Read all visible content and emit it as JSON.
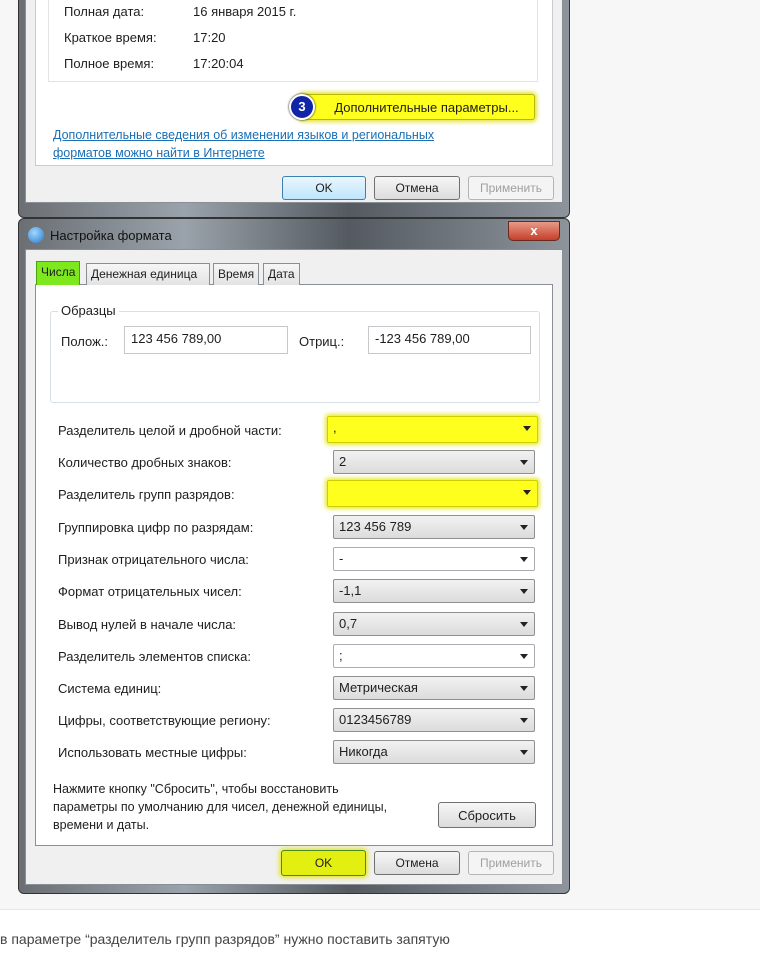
{
  "regional_window": {
    "rows": [
      {
        "label": "Полная дата:",
        "value": "16 января 2015 г."
      },
      {
        "label": "Краткое время:",
        "value": "17:20"
      },
      {
        "label": "Полное время:",
        "value": "17:20:04"
      }
    ],
    "step_badge": "3",
    "additional_button": "Дополнительные параметры...",
    "link_line1": "Дополнительные сведения об изменении языков и региональных",
    "link_line2": "форматов можно найти в Интернете",
    "ok": "OK",
    "cancel": "Отмена",
    "apply": "Применить"
  },
  "format_dialog": {
    "title": "Настройка формата",
    "close": "x",
    "tabs": [
      "Числа",
      "Денежная единица",
      "Время",
      "Дата"
    ],
    "samples": {
      "legend": "Образцы",
      "pos_label": "Полож.:",
      "pos_value": "123 456 789,00",
      "neg_label": "Отриц.:",
      "neg_value": "-123 456 789,00"
    },
    "settings": [
      {
        "label": "Разделитель целой и дробной части:",
        "value": ","
      },
      {
        "label": "Количество дробных знаков:",
        "value": "2"
      },
      {
        "label": "Разделитель групп разрядов:",
        "value": ""
      },
      {
        "label": "Группировка цифр по разрядам:",
        "value": "123 456 789"
      },
      {
        "label": "Признак отрицательного числа:",
        "value": "-"
      },
      {
        "label": "Формат отрицательных чисел:",
        "value": "-1,1"
      },
      {
        "label": "Вывод нулей в начале числа:",
        "value": "0,7"
      },
      {
        "label": "Разделитель элементов списка:",
        "value": ";"
      },
      {
        "label": "Система единиц:",
        "value": "Метрическая"
      },
      {
        "label": "Цифры, соответствующие региону:",
        "value": "0123456789"
      },
      {
        "label": "Использовать местные цифры:",
        "value": "Никогда"
      }
    ],
    "reset_text": [
      "Нажмите кнопку \"Сбросить\", чтобы восстановить",
      "параметры по умолчанию для чисел, денежной единицы,",
      "времени и даты."
    ],
    "reset_button": "Сбросить",
    "ok": "OK",
    "cancel": "Отмена",
    "apply": "Применить"
  },
  "caption": "в параметре “разделитель групп разрядов” нужно поставить запятую",
  "colors": {
    "highlight_yellow": "#ffff1e",
    "highlight_green": "#7ee81e",
    "link": "#1a6fb5",
    "badge": "#1024a8"
  }
}
